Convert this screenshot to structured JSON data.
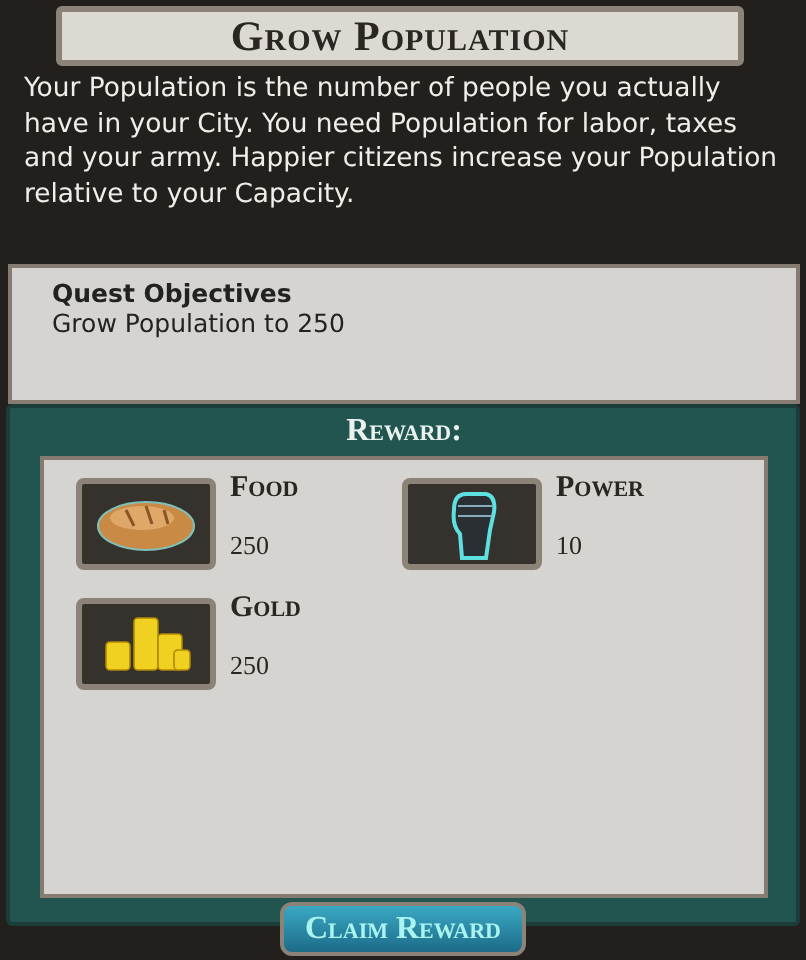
{
  "title": "Grow Population",
  "description": "Your Population is the number of people you actually have in your City. You need Population for labor, taxes and your army. Happier citizens increase your Population relative to your Capacity.",
  "objectives": {
    "heading": "Quest Objectives",
    "items": [
      "Grow Population to 250"
    ]
  },
  "reward": {
    "heading": "Reward:",
    "items": [
      {
        "kind": "food",
        "name": "Food",
        "amount": "250"
      },
      {
        "kind": "power",
        "name": "Power",
        "amount": "10"
      },
      {
        "kind": "gold",
        "name": "Gold",
        "amount": "250"
      }
    ]
  },
  "button": "Claim Reward"
}
